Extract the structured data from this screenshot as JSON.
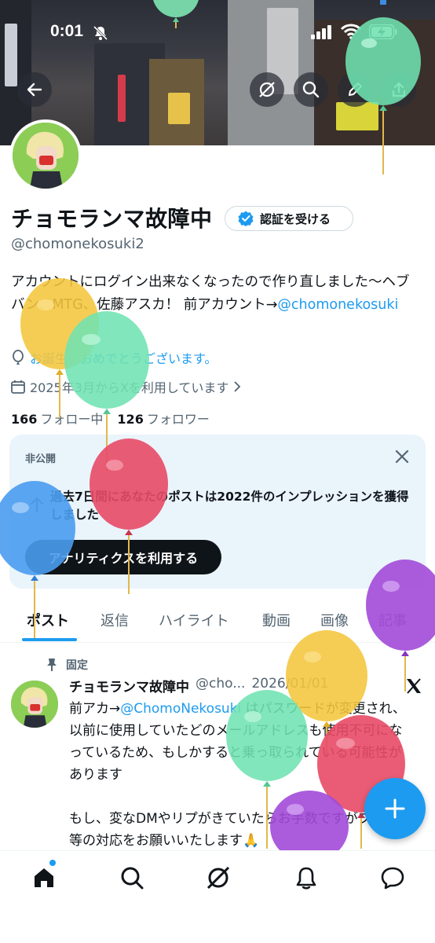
{
  "status_bar": {
    "time": "0:01"
  },
  "profile": {
    "display_name": "チョモランマ故障中",
    "verify_label": "認証を受ける",
    "handle": "@chomonekosuki2",
    "bio_text": "アカウントにログイン出来なくなったので作り直しました〜ヘブバン、MTG、佐藤アスカ！ 前アカウント→",
    "bio_mention": "@chomonekosuki",
    "birthday": "お誕生日おめでとうございます。",
    "joined": "2025年3月からXを利用しています",
    "following_count": "166",
    "following_label": "フォロー中",
    "followers_count": "126",
    "followers_label": "フォロワー"
  },
  "private_card": {
    "label": "非公開",
    "message": "過去7日間にあなたのポストは2022件のインプレッションを獲得しました",
    "button": "アナリティクスを利用する"
  },
  "tabs": [
    {
      "label": "ポスト",
      "active": true
    },
    {
      "label": "返信"
    },
    {
      "label": "ハイライト"
    },
    {
      "label": "動画"
    },
    {
      "label": "画像"
    },
    {
      "label": "記事"
    }
  ],
  "post": {
    "pinned_label": "固定",
    "author": "チョモランマ故障中",
    "handle_truncated": "@cho...",
    "date": "2026/01/01",
    "body_line1_prefix": "前アカ→",
    "body_mention": "@ChomoNekosuki",
    "body_line1_suffix": " はパスワードが変更され、以前に使用していたどのメールアドレスも使用不可になっているため、もしかすると乗っ取られている可能性があります",
    "body_para2": "もし、変なDMやリプがきていたらお手数ですがブロック等の対応をお願いいたします🙏"
  },
  "icons": {
    "back": "back-arrow-icon",
    "grok": "grok-icon",
    "search": "search-icon",
    "edit": "edit-icon",
    "share": "share-icon",
    "verified": "verified-badge-icon",
    "location": "location-icon",
    "calendar": "calendar-icon",
    "close": "close-icon",
    "pin": "pin-icon",
    "x_logo": "x-logo-icon",
    "compose": "plus-icon",
    "nav": [
      "home-icon",
      "search-icon",
      "grok-icon",
      "bell-icon",
      "message-icon"
    ]
  },
  "colors": {
    "accent": "#1d9bf0",
    "text": "#0f1419",
    "muted": "#536471",
    "avatar_bg": "#7dc24b"
  }
}
